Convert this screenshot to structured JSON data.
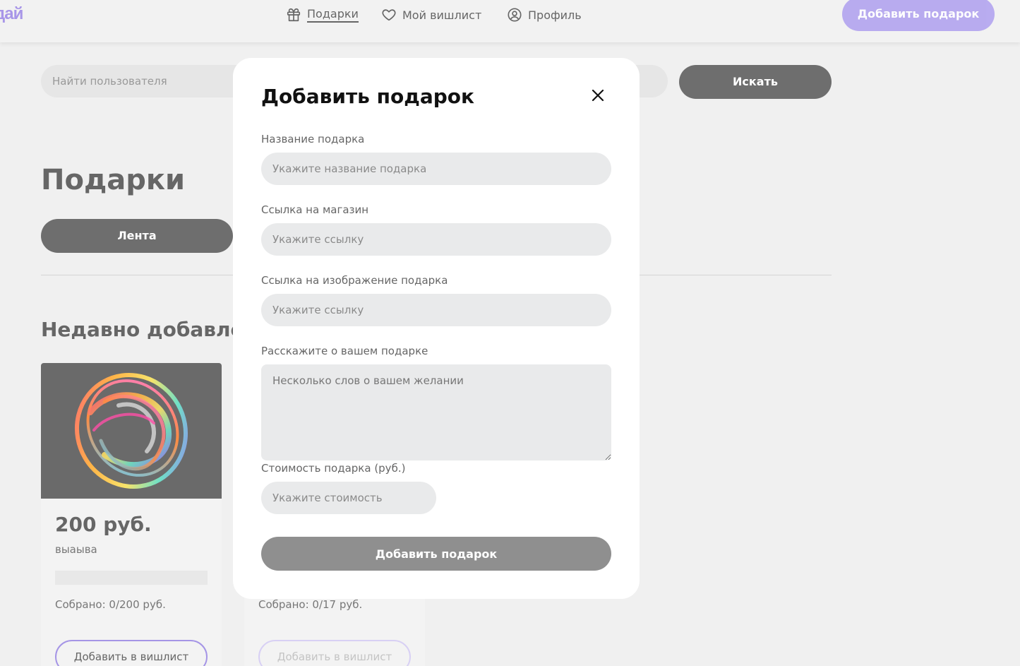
{
  "header": {
    "logo": "дай",
    "nav": [
      {
        "label": "Подарки",
        "icon": "gift-icon"
      },
      {
        "label": "Мой вишлист",
        "icon": "heart-icon"
      },
      {
        "label": "Профиль",
        "icon": "user-circle-icon"
      }
    ],
    "cta_label": "Добавить подарок"
  },
  "search": {
    "placeholder": "Найти пользователя",
    "button_label": "Искать"
  },
  "main": {
    "title": "Подарки",
    "feed_tab_label": "Лента",
    "recent_title": "Недавно добавленн"
  },
  "cards": [
    {
      "price": "200 руб.",
      "description": "выаыва",
      "collected": "Собрано: 0/200 руб.",
      "add_label": "Добавить в вишлист",
      "progress": 0
    },
    {
      "price": "",
      "description": "",
      "collected": "Собрано: 0/17 руб.",
      "add_label": "Добавить в вишлист",
      "progress": 0
    }
  ],
  "modal": {
    "title": "Добавить подарок",
    "fields": {
      "name": {
        "label": "Название подарка",
        "placeholder": "Укажите название подарка",
        "value": ""
      },
      "shop_link": {
        "label": "Ссылка на магазин",
        "placeholder": "Укажите ссылку",
        "value": ""
      },
      "image_link": {
        "label": "Ссылка на изображение подарка",
        "placeholder": "Укажите ссылку",
        "value": ""
      },
      "about": {
        "label": "Расскажите о вашем подарке",
        "placeholder": "Несколько слов о вашем желании",
        "value": ""
      },
      "price": {
        "label": "Стоимость подарка (руб.)",
        "placeholder": "Укажите стоимость",
        "value": ""
      }
    },
    "submit_label": "Добавить подарок"
  },
  "colors": {
    "accent": "#b5a8ef",
    "dark_button": "#6e6e6e",
    "submit_button": "#8f8f8f",
    "input_bg": "#e9eaeb"
  }
}
